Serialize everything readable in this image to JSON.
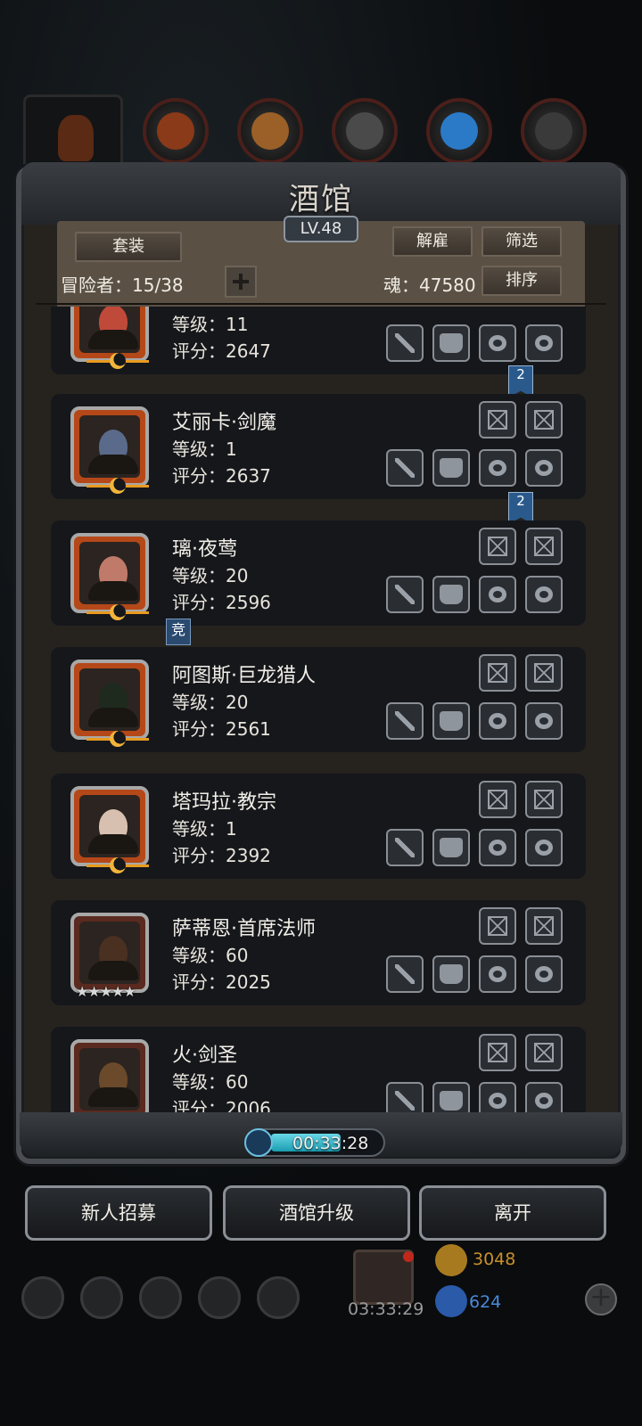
{
  "header": {
    "title": "酒馆",
    "level": "LV.48",
    "suit_label": "套装",
    "dismiss_label": "解雇",
    "filter_label": "筛选",
    "sort_label": "排序",
    "adventurers": "冒险者：15/38",
    "soul": "魂：47580"
  },
  "top_tabs": [
    "tab-hero-icon",
    "tab-shield-icon",
    "tab-wood-icon",
    "tab-iron-icon",
    "tab-crystal-icon",
    "tab-ore-icon"
  ],
  "heroes": [
    {
      "name": "",
      "level": "等级：11",
      "score": "评分：2647",
      "weapon": "axe-icon",
      "rank": "moon"
    },
    {
      "name": "艾丽卡·剑魔",
      "level": "等级：1",
      "score": "评分：2637",
      "weapon": "sword-icon",
      "rank": "moon",
      "ribbon": "2"
    },
    {
      "name": "璃·夜莺",
      "level": "等级：20",
      "score": "评分：2596",
      "weapon": "blade-icon",
      "rank": "moon",
      "ribbon": "2"
    },
    {
      "name": "阿图斯·巨龙猎人",
      "level": "等级：20",
      "score": "评分：2561",
      "weapon": "gun-icon",
      "rank": "moon",
      "tag": "竞"
    },
    {
      "name": "塔玛拉·教宗",
      "level": "等级：1",
      "score": "评分：2392",
      "weapon": "hammer-icon",
      "rank": "moon"
    },
    {
      "name": "萨蒂恩·首席法师",
      "level": "等级：60",
      "score": "评分：2025",
      "weapon": "staff-icon",
      "rank": "★★★★★"
    },
    {
      "name": "火·剑圣",
      "level": "等级：60",
      "score": "评分：2006",
      "weapon": "sword-icon",
      "rank": "★★★★★"
    }
  ],
  "timer": "00:33:28",
  "actions": {
    "recruit": "新人招募",
    "upgrade": "酒馆升级",
    "leave": "离开"
  },
  "dock": {
    "gift_timer": "03:33:29",
    "gold": "3048",
    "gems": "624"
  },
  "colors": {
    "accent_orange": "#b54818",
    "ribbon_blue": "#2a5a8c",
    "timer_cyan": "#6ad8e8",
    "gold_text": "#c8902a",
    "gem_text": "#4a8ad8"
  }
}
